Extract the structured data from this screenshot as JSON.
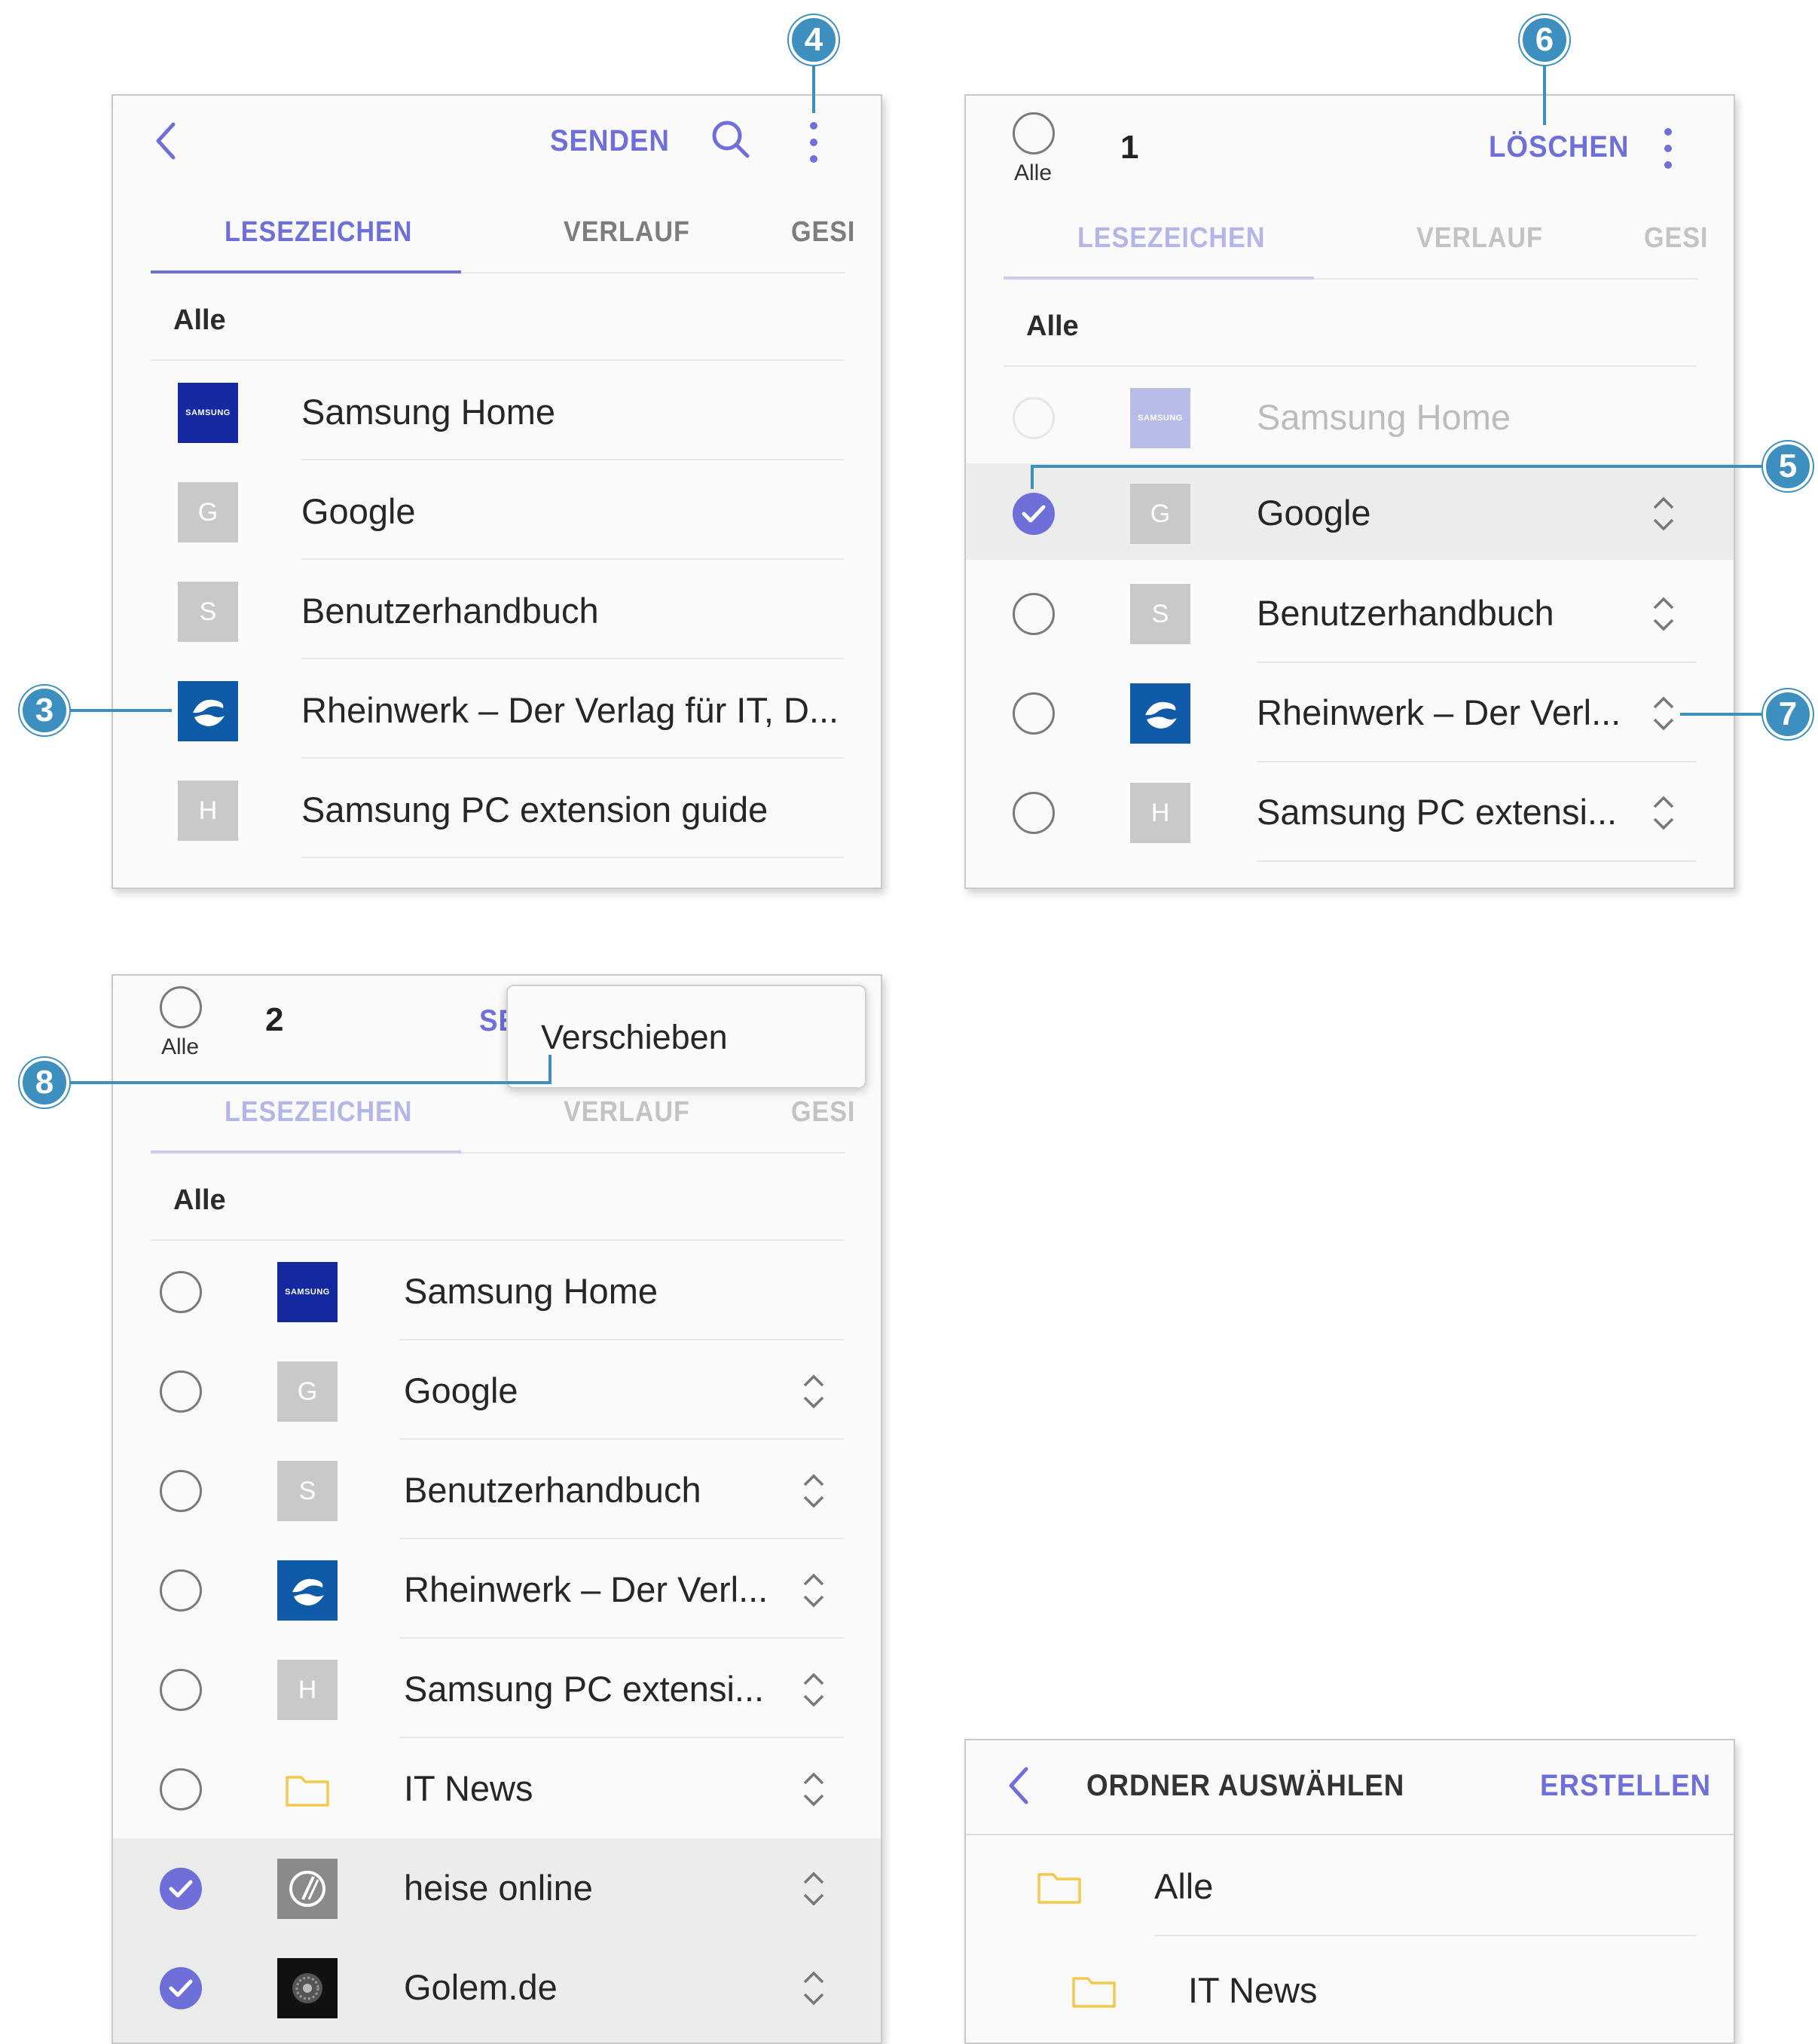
{
  "p1": {
    "send": "SENDEN",
    "tabs": [
      "LESEZEICHEN",
      "VERLAUF",
      "GESI"
    ],
    "alle": "Alle",
    "items": [
      {
        "title": "Samsung Home",
        "fav": "SAMSUNG"
      },
      {
        "title": "Google",
        "fav": "G"
      },
      {
        "title": "Benutzerhandbuch",
        "fav": "S"
      },
      {
        "title": "Rheinwerk – Der Verlag für IT, D...",
        "fav": ""
      },
      {
        "title": "Samsung PC extension guide",
        "fav": "H"
      }
    ]
  },
  "p2": {
    "select_all": "Alle",
    "count": "1",
    "delete": "LÖSCHEN",
    "tabs": [
      "LESEZEICHEN",
      "VERLAUF",
      "GESI"
    ],
    "alle": "Alle",
    "items": [
      {
        "title": "Samsung Home",
        "fav": "SAMSUNG"
      },
      {
        "title": "Google",
        "fav": "G"
      },
      {
        "title": "Benutzerhandbuch",
        "fav": "S"
      },
      {
        "title": "Rheinwerk – Der Verl...",
        "fav": ""
      },
      {
        "title": "Samsung PC extensi...",
        "fav": "H"
      }
    ]
  },
  "p3": {
    "select_all": "Alle",
    "count": "2",
    "partial_action": "SE",
    "menu_item": "Verschieben",
    "tabs": [
      "LESEZEICHEN",
      "VERLAUF",
      "GESI"
    ],
    "alle": "Alle",
    "items": [
      {
        "title": "Samsung Home",
        "fav": "SAMSUNG"
      },
      {
        "title": "Google",
        "fav": "G"
      },
      {
        "title": "Benutzerhandbuch",
        "fav": "S"
      },
      {
        "title": "Rheinwerk – Der Verl...",
        "fav": ""
      },
      {
        "title": "Samsung PC extensi...",
        "fav": "H"
      },
      {
        "title": "IT News",
        "fav": ""
      },
      {
        "title": "heise online",
        "fav": ""
      },
      {
        "title": "Golem.de",
        "fav": ""
      }
    ]
  },
  "p4": {
    "title": "ORDNER AUSWÄHLEN",
    "create": "ERSTELLEN",
    "folders": [
      "Alle",
      "IT News"
    ]
  },
  "callouts": [
    "3",
    "4",
    "5",
    "6",
    "7",
    "8"
  ],
  "colors": {
    "accent": "#6e6fd8",
    "callout": "#3d8fbf",
    "samsung": "#1428a0",
    "rheinwerk": "#0f5ba8",
    "folder": "#f2c94c"
  }
}
